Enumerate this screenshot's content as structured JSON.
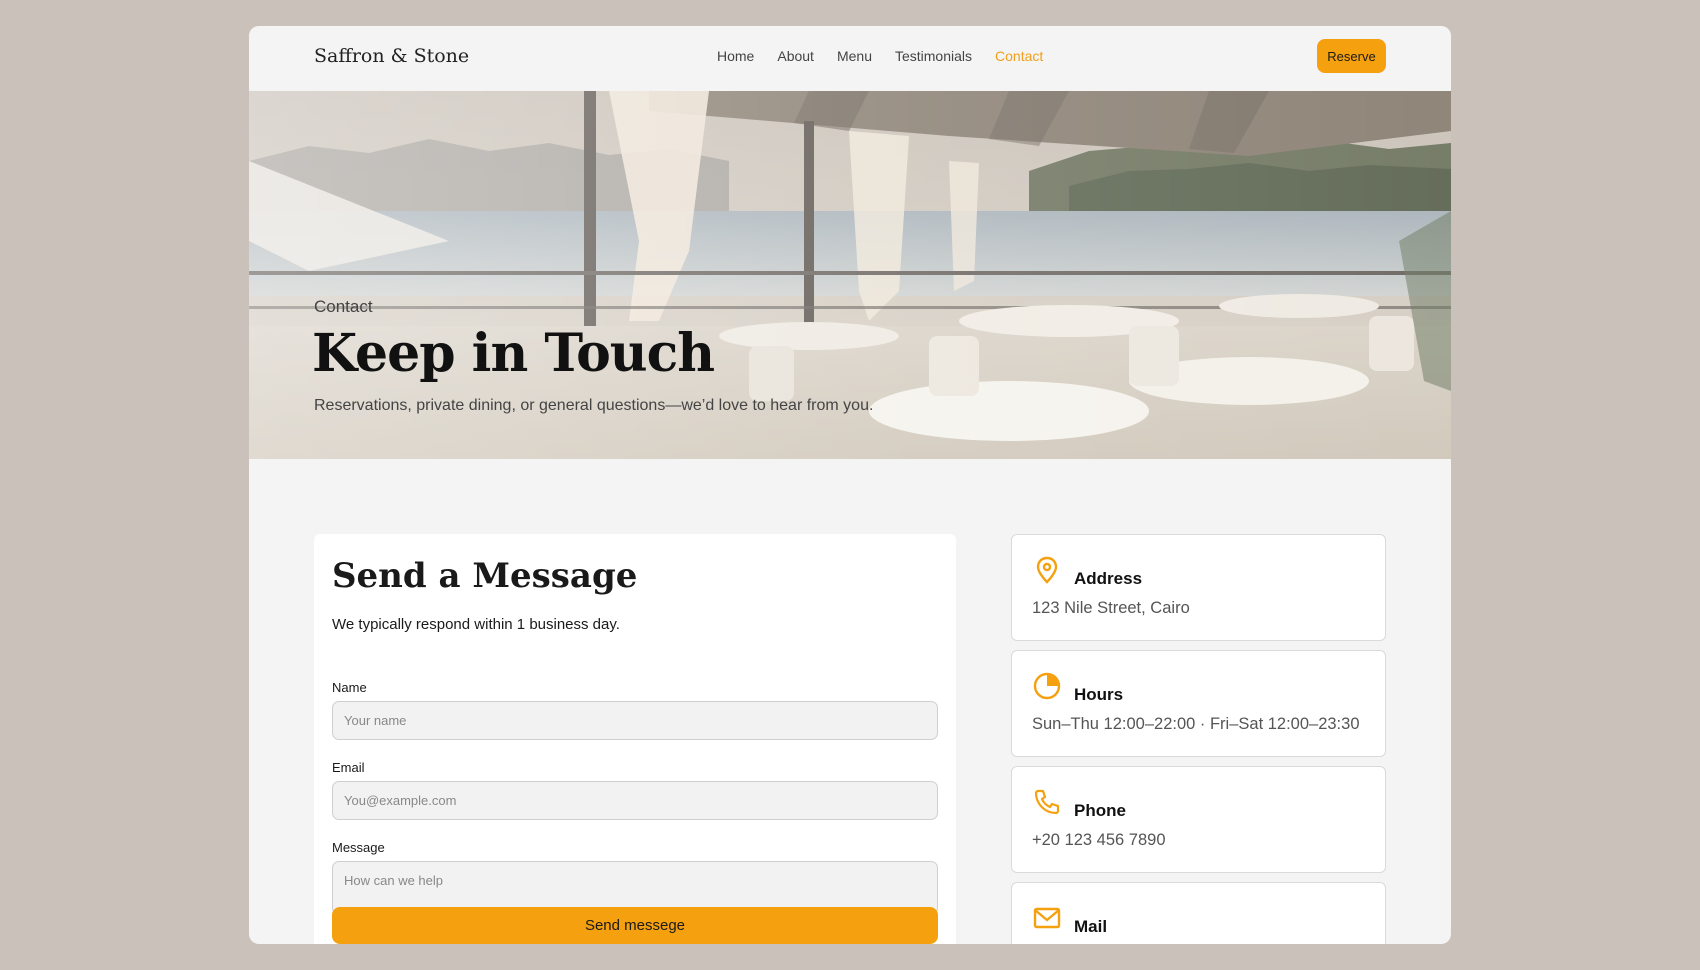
{
  "header": {
    "logo": "Saffron & Stone",
    "nav": [
      "Home",
      "About",
      "Menu",
      "Testimonials",
      "Contact"
    ],
    "active_nav": "Contact",
    "reserve_label": "Reserve"
  },
  "hero": {
    "eyebrow": "Contact",
    "title": "Keep in Touch",
    "subtitle": "Reservations, private dining, or general questions—we’d love to hear from you."
  },
  "form": {
    "title": "Send a Message",
    "note": "We typically respond within 1 business day.",
    "name_label": "Name",
    "name_placeholder": "Your name",
    "email_label": "Email",
    "email_placeholder": "You@example.com",
    "message_label": "Message",
    "message_placeholder": "How can we help",
    "submit_label": "Send messege"
  },
  "info": [
    {
      "icon": "map-pin-icon",
      "title": "Address",
      "value": "123 Nile Street, Cairo"
    },
    {
      "icon": "clock-icon",
      "title": "Hours",
      "value": "Sun–Thu 12:00–22:00 · Fri–Sat 12:00–23:30"
    },
    {
      "icon": "phone-icon",
      "title": "Phone",
      "value": "+20 123 456 7890"
    },
    {
      "icon": "mail-icon",
      "title": "Mail",
      "value": ""
    }
  ],
  "colors": {
    "accent": "#f5a00e",
    "background": "#cac1bb",
    "page": "#f4f4f4"
  }
}
